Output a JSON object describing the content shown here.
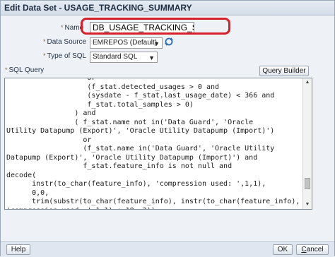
{
  "dialog": {
    "title": "Edit Data Set - USAGE_TRACKING_SUMMARY"
  },
  "form": {
    "name_label": "Name",
    "name_value": "DB_USAGE_TRACKING_SUMM",
    "data_source_label": "Data Source",
    "data_source_value": "EMREPOS (Default)",
    "type_of_sql_label": "Type of SQL",
    "type_of_sql_value": "Standard SQL",
    "sql_query_label": "SQL Query",
    "required_marker": "*"
  },
  "buttons": {
    "query_builder": "Query Builder",
    "help": "Help",
    "ok": "OK",
    "cancel_prefix": "",
    "cancel_mnemonic": "C",
    "cancel_rest": "ancel"
  },
  "sql_lines": [
    "                   or",
    "                   (f_stat.detected_usages > 0 and",
    "                   (sysdate - f_stat.last_usage_date) < 366 and",
    "                   f_stat.total_samples > 0)",
    "                ) and",
    "                ( f_stat.name not in('Data Guard', 'Oracle",
    "Utility Datapump (Export)', 'Oracle Utility Datapump (Import)')",
    "                  or",
    "                  (f_stat.name in('Data Guard', 'Oracle Utility",
    "Datapump (Export)', 'Oracle Utility Datapump (Import)') and",
    "                  f_stat.feature_info is not null and",
    "decode(",
    "      instr(to_char(feature_info), 'compression used: ',1,1),",
    "      0,0,",
    "      trim(substr(to_char(feature_info), instr(to_char(feature_info),",
    "'compression used: ',1,1) + 18, 2))"
  ]
}
